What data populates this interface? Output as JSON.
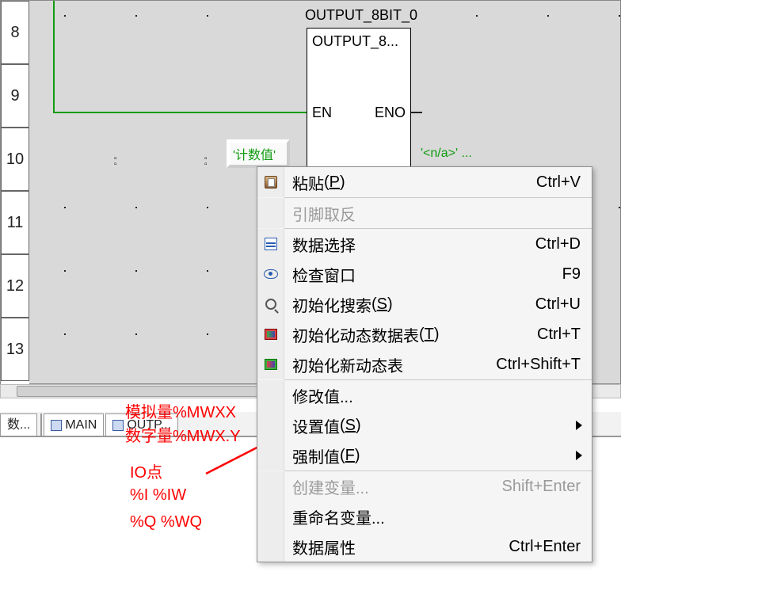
{
  "ruler": [
    "8",
    "9",
    "10",
    "11",
    "12",
    "13"
  ],
  "fb": {
    "title_above": "OUTPUT_8BIT_0",
    "title_in": "OUTPUT_8...",
    "pin_en": "EN",
    "pin_eno": "ENO"
  },
  "counter": {
    "line1": "'计数值'"
  },
  "na_text": "'<n/a>' ...",
  "tabs": {
    "t1": "数...",
    "t2": "MAIN",
    "t3": "OUTP..."
  },
  "anno": {
    "l1": "模拟量%MWXX",
    "l2": "数字量%MWX.Y",
    "l3": "IO点",
    "l4": "%I %IW",
    "l5": "%Q %WQ"
  },
  "menu": {
    "paste": "粘贴",
    "paste_accel": "P",
    "paste_sc": "Ctrl+V",
    "pinneg": "引脚取反",
    "datasel": "数据选择",
    "datasel_sc": "Ctrl+D",
    "inspect": "检查窗口",
    "inspect_sc": "F9",
    "initsearch": "初始化搜索",
    "initsearch_accel": "S",
    "initsearch_sc": "Ctrl+U",
    "initdyn": "初始化动态数据表",
    "initdyn_accel": "T",
    "initdyn_sc": "Ctrl+T",
    "initnew": "初始化新动态表",
    "initnew_sc": "Ctrl+Shift+T",
    "modval": "修改值...",
    "setval": "设置值",
    "setval_accel": "S",
    "forceval": "强制值",
    "forceval_accel": "F",
    "createvar": "创建变量...",
    "createvar_sc": "Shift+Enter",
    "renamevar": "重命名变量...",
    "dataprop": "数据属性",
    "dataprop_sc": "Ctrl+Enter"
  }
}
